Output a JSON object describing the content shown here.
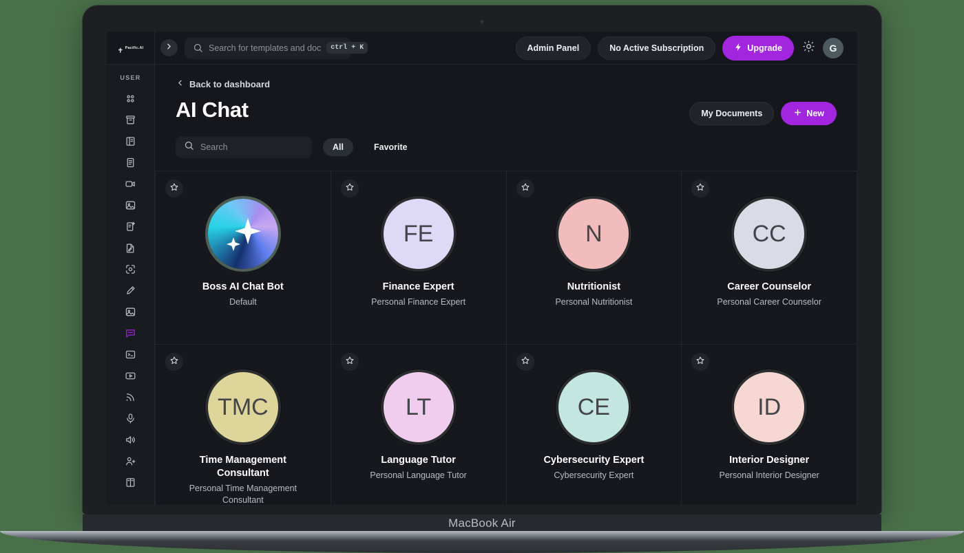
{
  "device": {
    "label": "MacBook Air"
  },
  "topbar": {
    "brand_name": "Pacific.AI",
    "collapse_icon": "chevron-right-icon",
    "search": {
      "placeholder": "Search for templates and doc",
      "shortcut": "ctrl + K",
      "icon": "search-icon"
    },
    "admin_panel_label": "Admin Panel",
    "subscription_label": "No Active Subscription",
    "upgrade_label": "Upgrade",
    "upgrade_icon": "bolt-icon",
    "theme_icon": "sun-icon",
    "avatar_initial": "G"
  },
  "sidebar": {
    "heading": "USER",
    "items": [
      {
        "icon": "grid-dots-icon",
        "name": "dashboard",
        "active": false
      },
      {
        "icon": "archive-box-icon",
        "name": "archive",
        "active": false
      },
      {
        "icon": "book-panel-icon",
        "name": "library",
        "active": false
      },
      {
        "icon": "document-lines-icon",
        "name": "documents",
        "active": false
      },
      {
        "icon": "video-camera-icon",
        "name": "video",
        "active": false
      },
      {
        "icon": "image-icon",
        "name": "images",
        "active": false
      },
      {
        "icon": "file-sparkle-icon",
        "name": "ai-writer",
        "active": false
      },
      {
        "icon": "file-pencil-icon",
        "name": "editor",
        "active": false
      },
      {
        "icon": "scan-face-icon",
        "name": "vision",
        "active": false
      },
      {
        "icon": "pen-icon",
        "name": "draw",
        "active": false
      },
      {
        "icon": "photo-icon",
        "name": "gallery",
        "active": false
      },
      {
        "icon": "chat-bubble-icon",
        "name": "ai-chat",
        "active": true
      },
      {
        "icon": "terminal-icon",
        "name": "code",
        "active": false
      },
      {
        "icon": "play-box-icon",
        "name": "player",
        "active": false
      },
      {
        "icon": "rss-icon",
        "name": "feed",
        "active": false
      },
      {
        "icon": "microphone-icon",
        "name": "voice",
        "active": false
      },
      {
        "icon": "speaker-icon",
        "name": "audio",
        "active": false
      },
      {
        "icon": "user-plus-icon",
        "name": "invite",
        "active": false
      },
      {
        "icon": "book-open-icon",
        "name": "docs",
        "active": false
      }
    ]
  },
  "main": {
    "back_label": "Back to dashboard",
    "back_icon": "chevron-left-icon",
    "title": "AI Chat",
    "my_documents_label": "My Documents",
    "new_label": "New",
    "new_icon": "plus-icon",
    "filter": {
      "search_placeholder": "Search",
      "search_icon": "search-icon",
      "tabs": [
        {
          "label": "All",
          "selected": true
        },
        {
          "label": "Favorite",
          "selected": false
        }
      ]
    },
    "cards": [
      {
        "title": "Boss AI Chat Bot",
        "subtitle": "Default",
        "initials": "",
        "avatar_type": "sparkle-gradient",
        "bg": "#5f7ff0",
        "favorite_icon": "star-outline-icon"
      },
      {
        "title": "Finance Expert",
        "subtitle": "Personal Finance Expert",
        "initials": "FE",
        "avatar_type": "initials",
        "bg": "#ded9f6",
        "favorite_icon": "star-outline-icon"
      },
      {
        "title": "Nutritionist",
        "subtitle": "Personal Nutritionist",
        "initials": "N",
        "avatar_type": "initials",
        "bg": "#f2bcbc",
        "favorite_icon": "star-outline-icon"
      },
      {
        "title": "Career Counselor",
        "subtitle": "Personal Career Counselor",
        "initials": "CC",
        "avatar_type": "initials",
        "bg": "#d9dbe6",
        "favorite_icon": "star-outline-icon"
      },
      {
        "title": "Time Management Consultant",
        "subtitle": "Personal Time Management Consultant",
        "initials": "TMC",
        "avatar_type": "initials",
        "bg": "#ddd59a",
        "favorite_icon": "star-outline-icon"
      },
      {
        "title": "Language Tutor",
        "subtitle": "Personal Language Tutor",
        "initials": "LT",
        "avatar_type": "initials",
        "bg": "#f0ccee",
        "favorite_icon": "star-outline-icon"
      },
      {
        "title": "Cybersecurity Expert",
        "subtitle": "Cybersecurity Expert",
        "initials": "CE",
        "avatar_type": "initials",
        "bg": "#c4e6e1",
        "favorite_icon": "star-outline-icon"
      },
      {
        "title": "Interior Designer",
        "subtitle": "Personal Interior Designer",
        "initials": "ID",
        "avatar_type": "initials",
        "bg": "#f6d7d2",
        "favorite_icon": "star-outline-icon"
      }
    ]
  },
  "colors": {
    "accent": "#a225e0",
    "page_bg": "#15171c",
    "panel_bg": "#181b20",
    "border": "#22252b",
    "desktop_bg": "#4a7049"
  }
}
